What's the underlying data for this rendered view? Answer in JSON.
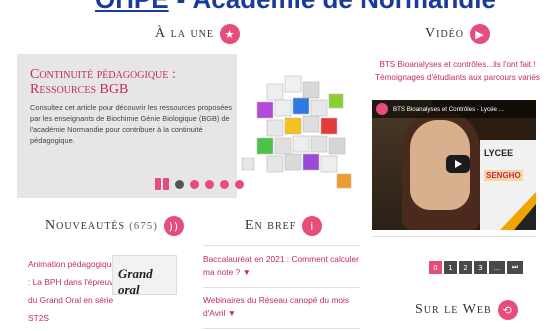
{
  "top": {
    "link_text": "ОПРЕ",
    "title_rest": "- Académie de Normandie"
  },
  "une": {
    "title": "À la une",
    "icon": "star-icon",
    "headline": "Continuité pédagogique : Ressources BGB",
    "text": "Consultez cet article pour découvrir les ressources proposées par les enseignants de Biochimie Génie Biologique (BGB) de l'académie Normandie pour contribuer à la continuité pédagogique."
  },
  "nouv": {
    "title": "Nouveautés",
    "count": "(675)",
    "icon": "rss-icon",
    "item": "Animation pédagogique : La BPH dans l'épreuve du Grand Oral en série ST2S",
    "thumb_text": "Grand oral"
  },
  "bref": {
    "title": "En bref",
    "icon": "info-icon",
    "items": [
      "Baccalauréat en 2021 : Comment calculer ma note ? ▼",
      "Webinaires du Réseau canopé du mois d'Avril ▼"
    ]
  },
  "video": {
    "title": "Vidéo",
    "icon": "video-camera-icon",
    "headline": "BTS Bioanalyses et contrôles...ils l'ont fait ! Témoignages d'étudiants aux parcours variés",
    "player_caption": "BTS Bioanalyses et Contrôles - Lycée ...",
    "school_label": "LYCEE",
    "school_name": "SENGHO"
  },
  "pager": [
    "0",
    "1",
    "2",
    "3",
    "...",
    "⏭"
  ],
  "web": {
    "title": "Sur le Web",
    "icon": "link-icon"
  },
  "colors": {
    "accent": "#e64d7a",
    "link": "#c52a63",
    "card_bg": "#e6e6e6"
  }
}
